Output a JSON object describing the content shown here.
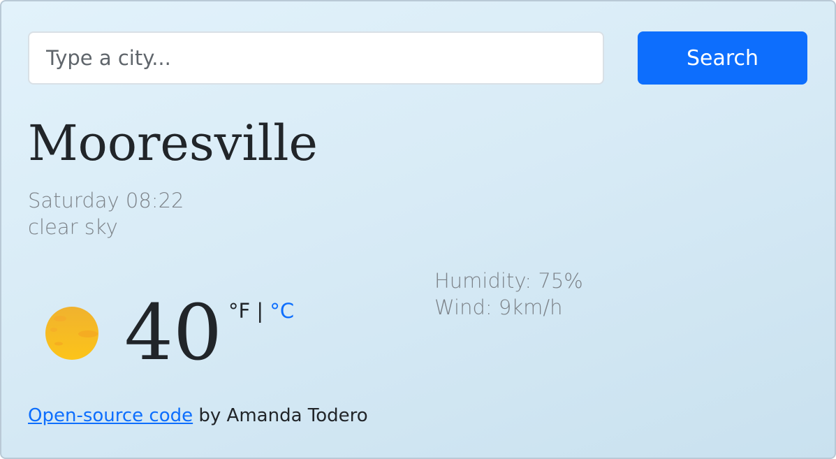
{
  "search": {
    "placeholder": "Type a city...",
    "value": "",
    "button_label": "Search"
  },
  "city": {
    "name": "Mooresville",
    "datetime": "Saturday 08:22",
    "description": "clear sky"
  },
  "current": {
    "temperature": "40",
    "unit_fahrenheit": "°F",
    "unit_separator": "|",
    "unit_celsius": "°C",
    "icon": "sun-icon",
    "humidity": "Humidity: 75%",
    "wind": "Wind: 9km/h"
  },
  "footer": {
    "link_text": "Open-source code",
    "suffix_text": " by Amanda Todero"
  },
  "colors": {
    "accent": "#0d6efd",
    "background_top": "#e2f2fb",
    "background_bottom": "#c9e1ef",
    "muted_text": "#7c8288",
    "sun_light": "#fbd34d",
    "sun_dark": "#f0a91a"
  }
}
